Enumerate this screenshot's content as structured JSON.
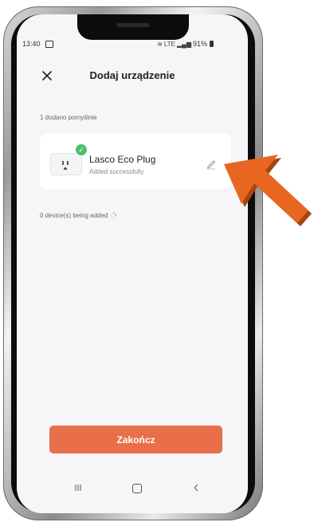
{
  "status_bar": {
    "time": "13:40",
    "network": "LTE",
    "battery": "91%"
  },
  "header": {
    "title": "Dodaj urządzenie",
    "close_icon": "close-icon"
  },
  "summary": {
    "added_text": "1 dodano pomyślnie"
  },
  "device_card": {
    "name": "Lasco Eco Plug",
    "status": "Added successfully",
    "image": "smart-plug-image",
    "badge_icon": "check-circle-icon",
    "edit_icon": "pencil-icon"
  },
  "adding": {
    "text": "0 device(s) being added",
    "icon": "spinner-icon"
  },
  "actions": {
    "finish_label": "Zakończ"
  },
  "nav": {
    "recents_icon": "recents-icon",
    "home_icon": "home-icon",
    "back_icon": "back-icon"
  },
  "colors": {
    "accent": "#e86f4a",
    "success": "#4cbf6b",
    "arrow": "#e8661f",
    "screen_bg": "#f6f6f8"
  }
}
